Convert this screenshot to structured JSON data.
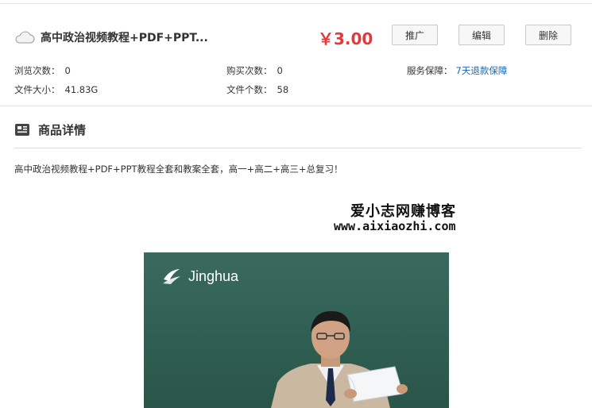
{
  "product": {
    "title": "高中政治视频教程+PDF+PPT...",
    "price": "￥3.00",
    "buttons": {
      "promote": "推广",
      "edit": "编辑",
      "delete": "删除"
    },
    "icon": "cloud-icon"
  },
  "stats": {
    "views_label": "浏览次数：",
    "views_value": "0",
    "purchases_label": "购买次数：",
    "purchases_value": "0",
    "service_label": "服务保障：",
    "service_value": "7天退款保障",
    "size_label": "文件大小：",
    "size_value": "41.83G",
    "count_label": "文件个数：",
    "count_value": "58"
  },
  "details": {
    "title": "商品详情",
    "icon": "newspaper-icon",
    "description": "高中政治视频教程+PDF+PPT教程全套和教案全套，高一+高二+高三+总复习！"
  },
  "watermark": {
    "line1": "爱小志网赚博客",
    "line2": "www.aixiaozhi.com"
  },
  "video": {
    "logo_text": "Jinghua"
  },
  "colors": {
    "price": "#e4393c",
    "link": "#1a66b3",
    "board": "#2f5f52"
  }
}
